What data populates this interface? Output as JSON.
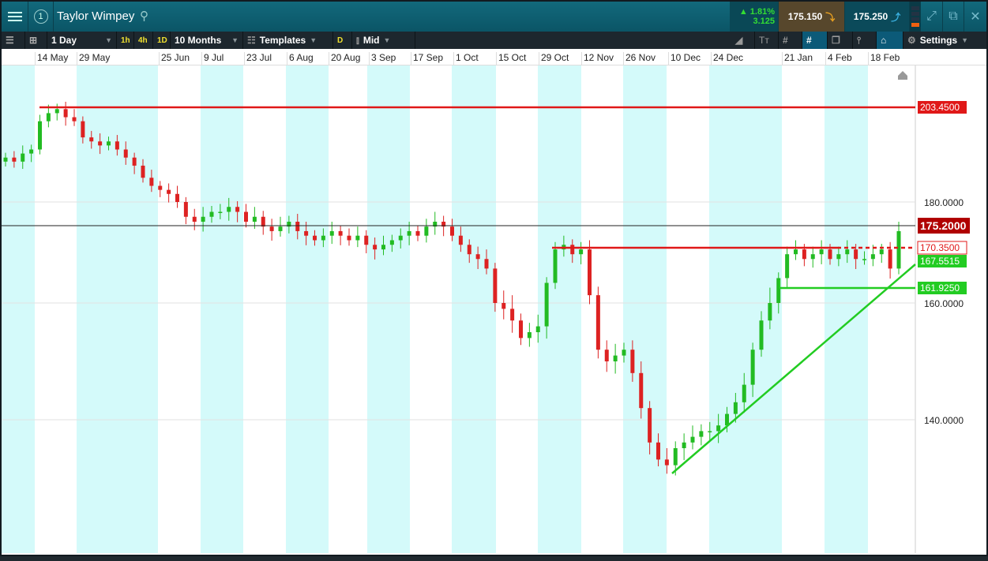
{
  "header": {
    "title": "Taylor Wimpey",
    "workspace_number": "1",
    "change_pct": "1.81%",
    "change_abs": "3.125",
    "sell_price": "175.150",
    "buy_price": "175.250"
  },
  "toolbar": {
    "interval": "1 Day",
    "quick_1h": "1h",
    "quick_4h": "4h",
    "quick_1d": "1D",
    "range": "10 Months",
    "templates": "Templates",
    "d_badge": "D",
    "price_type": "Mid",
    "settings": "Settings"
  },
  "date_labels": [
    "14 May",
    "29 May",
    "25 Jun",
    "9 Jul",
    "23 Jul",
    "6 Aug",
    "20 Aug",
    "3 Sep",
    "17 Sep",
    "1 Oct",
    "15 Oct",
    "29 Oct",
    "12 Nov",
    "26 Nov",
    "10 Dec",
    "24 Dec",
    "21 Jan",
    "4 Feb",
    "18 Feb"
  ],
  "chart_data": {
    "type": "candlestick",
    "title": "Taylor Wimpey",
    "y_ticks": [
      180,
      160,
      140
    ],
    "y_tick_labels": [
      "180.0000",
      "160.0000",
      "140.0000"
    ],
    "closes": [
      191,
      190,
      192,
      193,
      200,
      202,
      203,
      201,
      200,
      196,
      195,
      194,
      195,
      193,
      191,
      189,
      186,
      184,
      183,
      182,
      180,
      177,
      176,
      177,
      178,
      178,
      179,
      178,
      176,
      177,
      175,
      174,
      175,
      176,
      174,
      173,
      172,
      173,
      174,
      173,
      172,
      173,
      171,
      170,
      171,
      172,
      173,
      174,
      173,
      175,
      176,
      175,
      173,
      171,
      169,
      168,
      166,
      160,
      159,
      157,
      154,
      155,
      156,
      163,
      170,
      171,
      169,
      170,
      161,
      152,
      150,
      151,
      152,
      148,
      142,
      136,
      133,
      132,
      135,
      136,
      137,
      138,
      138,
      139,
      141,
      143,
      146,
      152,
      157,
      160,
      164,
      169,
      170,
      168,
      169,
      170,
      168,
      169,
      170,
      168,
      168,
      169,
      170,
      166,
      174
    ],
    "levels": {
      "resistance_high": "203.4500",
      "current": "175.2000",
      "resistance": "170.3500",
      "trendline": "167.5515",
      "support": "161.9250"
    },
    "colors": {
      "up": "#22bb22",
      "down": "#dd2222",
      "resistance": "#e01818",
      "support": "#22cc22",
      "current": "#b00000",
      "band": "#d4fafa"
    }
  }
}
